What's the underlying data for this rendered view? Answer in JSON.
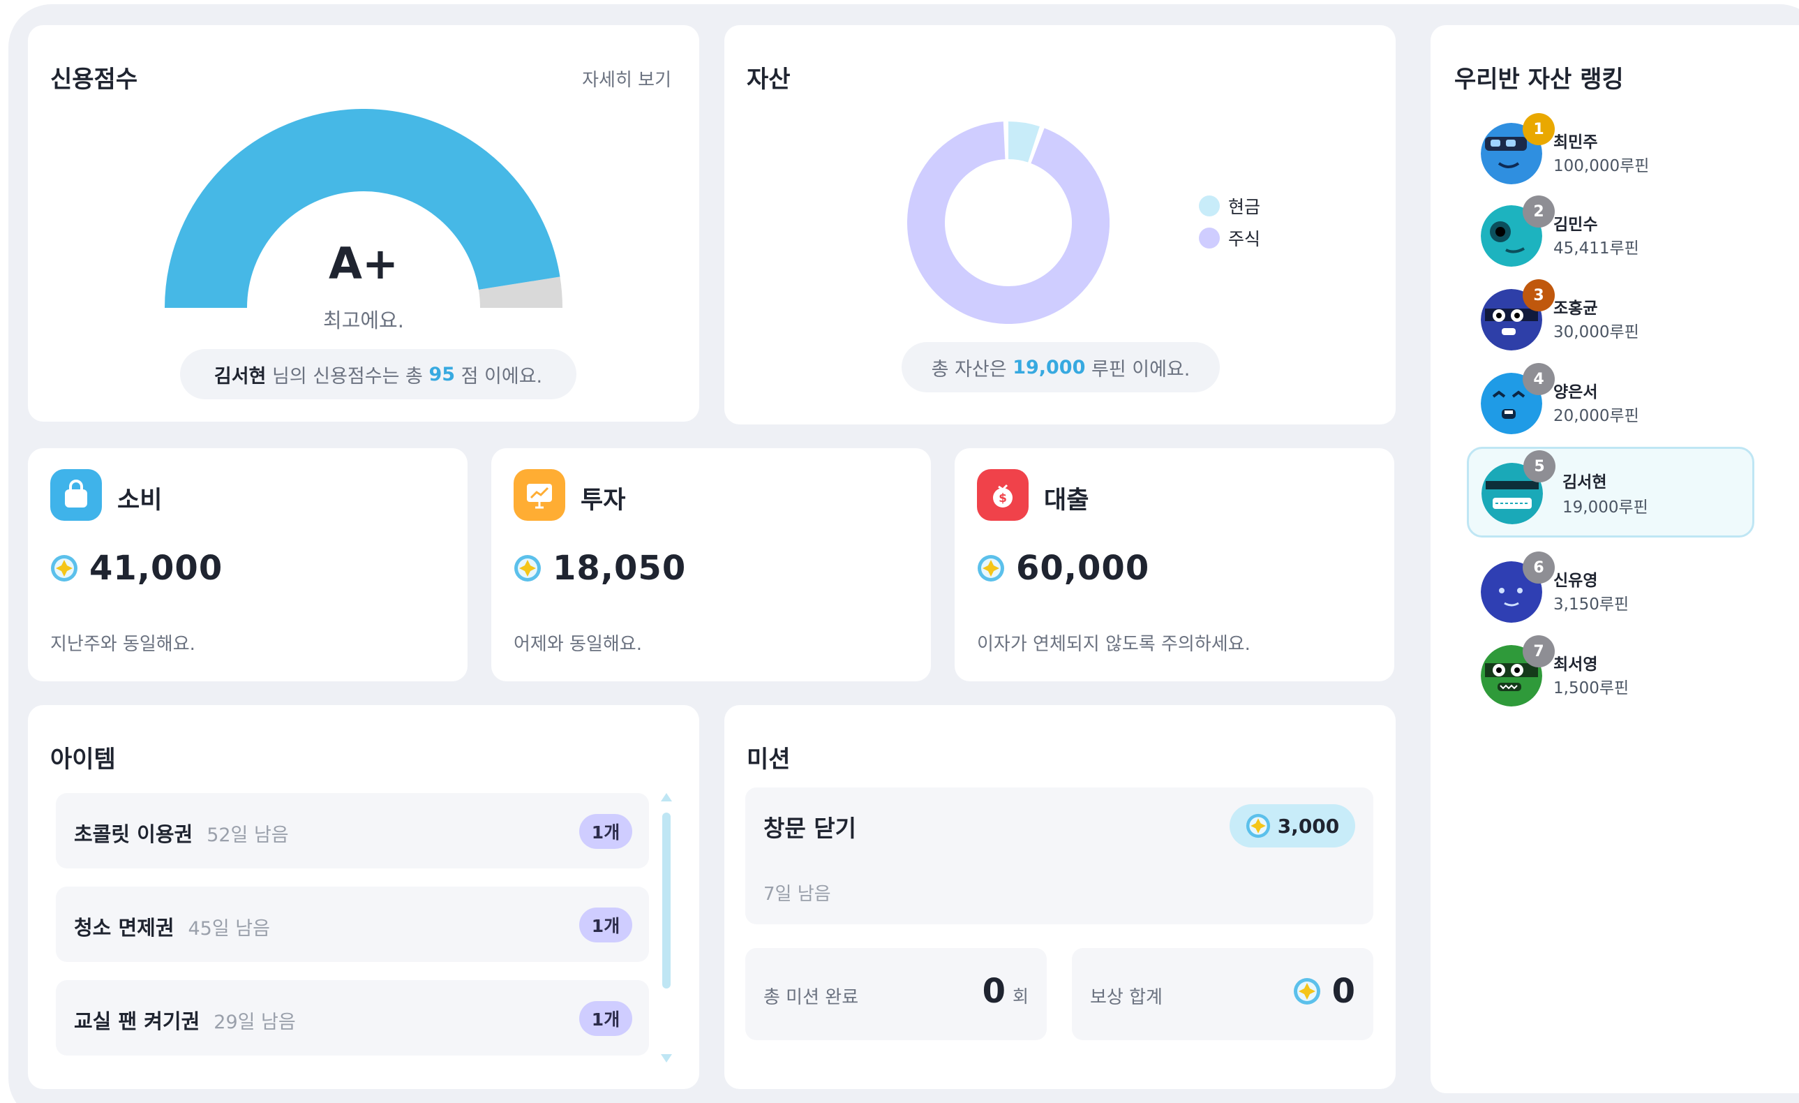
{
  "colors": {
    "gauge_fill": "#46b8e6",
    "gauge_rest": "#d9d9d9",
    "cash": "#c8ecf9",
    "stock": "#cfcdff",
    "accent": "#37a9e0"
  },
  "credit": {
    "title": "신용점수",
    "detail_link": "자세히 보기",
    "grade": "A+",
    "grade_text": "최고에요.",
    "score": 95,
    "score_fraction": 0.95,
    "summary": {
      "name": "김서현",
      "mid": " 님의 신용점수는 총 ",
      "score": "95",
      "tail": " 점 이에요."
    }
  },
  "asset": {
    "title": "자산",
    "legend": [
      {
        "label": "현금"
      },
      {
        "label": "주식"
      }
    ],
    "cash_fraction": 0.05,
    "summary": {
      "pre": "총 자산은 ",
      "amount": "19,000",
      "tail": " 루핀 이에요."
    }
  },
  "ranking": {
    "title": "우리반 자산 랭킹",
    "items": [
      {
        "rank": "1",
        "name": "최민주",
        "amount": "100,000루핀"
      },
      {
        "rank": "2",
        "name": "김민수",
        "amount": "45,411루핀"
      },
      {
        "rank": "3",
        "name": "조홍균",
        "amount": "30,000루핀"
      },
      {
        "rank": "4",
        "name": "양은서",
        "amount": "20,000루핀"
      },
      {
        "rank": "5",
        "name": "김서현",
        "amount": "19,000루핀"
      },
      {
        "rank": "6",
        "name": "신유영",
        "amount": "3,150루핀"
      },
      {
        "rank": "7",
        "name": "최서영",
        "amount": "1,500루핀"
      }
    ]
  },
  "stats": {
    "spend": {
      "title": "소비",
      "value": "41,000",
      "note": "지난주와 동일해요."
    },
    "invest": {
      "title": "투자",
      "value": "18,050",
      "note": "어제와 동일해요."
    },
    "loan": {
      "title": "대출",
      "value": "60,000",
      "note": "이자가 연체되지 않도록 주의하세요."
    }
  },
  "items": {
    "title": "아이템",
    "list": [
      {
        "name": "초콜릿 이용권",
        "days": "52일 남음",
        "count": "1개"
      },
      {
        "name": "청소 면제권",
        "days": "45일 남음",
        "count": "1개"
      },
      {
        "name": "교실 팬 켜기권",
        "days": "29일 남음",
        "count": "1개"
      }
    ]
  },
  "mission": {
    "title": "미션",
    "current": {
      "name": "창문 닫기",
      "reward": "3,000",
      "days": "7일 남음"
    },
    "total_label": "총 미션 완료",
    "total_value": "0",
    "total_unit": "회",
    "reward_label": "보상 합계",
    "reward_value": "0"
  }
}
